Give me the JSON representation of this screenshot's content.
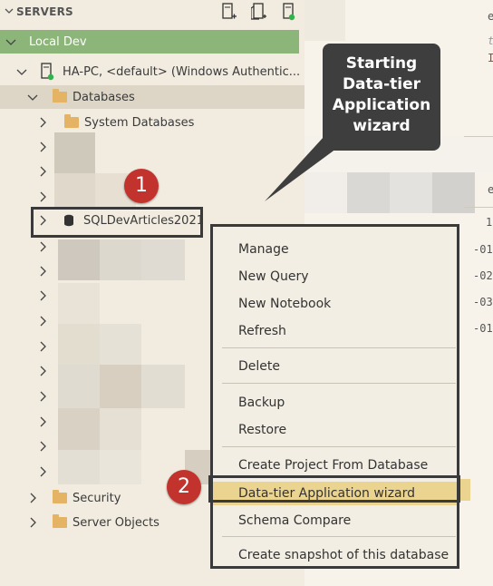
{
  "sidebar": {
    "header": "SERVERS",
    "server_group": "Local Dev",
    "server": "HA-PC, <default> (Windows Authentic...",
    "databases": "Databases",
    "system_databases": "System Databases",
    "selected_db": "SQLDevArticles2021",
    "security": "Security",
    "server_objects": "Server Objects"
  },
  "context_menu": {
    "items": [
      "Manage",
      "New Query",
      "New Notebook",
      "Refresh",
      "Delete",
      "Backup",
      "Restore",
      "Create Project From Database",
      "Data-tier Application wizard",
      "Schema Compare",
      "Create snapshot of this database"
    ],
    "highlighted": "Data-tier Application wizard"
  },
  "annotations": {
    "callout": "Starting Data-tier Application wizard",
    "badge1": "1",
    "badge2": "2"
  },
  "editor_fragments": {
    "lines": [
      "e",
      "t",
      "I",
      "e",
      "1",
      "-01",
      "-02",
      "-03",
      "-01"
    ]
  },
  "colors": {
    "background": "#f1ecdf",
    "selected_group": "#8cb57a",
    "menu_highlight": "#ebd48f",
    "badge": "#c2332e",
    "callout": "#3e3e3e",
    "status_dot": "#2fb34a"
  }
}
